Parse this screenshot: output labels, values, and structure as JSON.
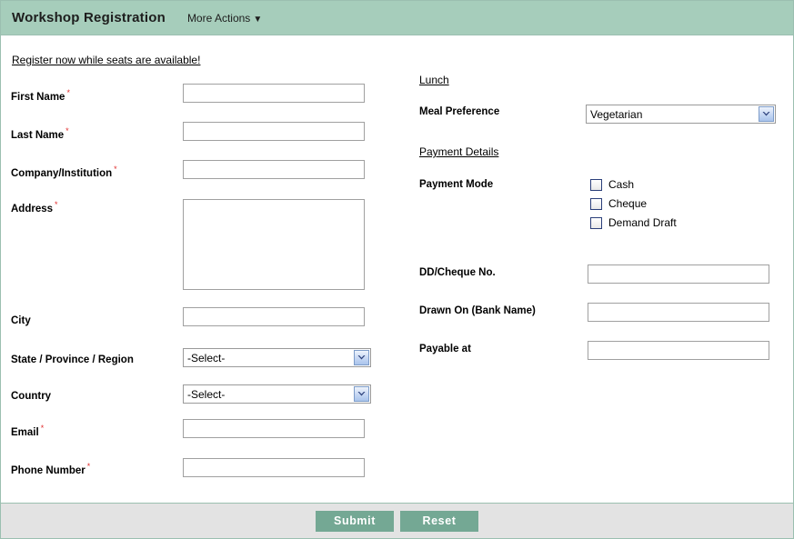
{
  "header": {
    "title": "Workshop Registration",
    "more_actions_label": "More Actions",
    "caret_icon": "chevron-down-icon"
  },
  "intro": {
    "text": "Register now while seats are available!"
  },
  "theme": {
    "header_bg": "#a6cdbb",
    "button_bg": "#74a894",
    "footer_bg": "#e3e3e3",
    "border": "#9bbfb0",
    "required_mark": "#e03030"
  },
  "left_column": {
    "fields": [
      {
        "label": "First Name",
        "required": "*",
        "type": "text",
        "value": ""
      },
      {
        "label": "Last Name",
        "required": "*",
        "type": "text",
        "value": ""
      },
      {
        "label": "Company/Institution",
        "required": "*",
        "type": "text",
        "value": ""
      },
      {
        "label": "Address",
        "required": "*",
        "type": "textarea",
        "value": ""
      },
      {
        "label": "City",
        "required": "",
        "type": "text",
        "value": ""
      },
      {
        "label": "State / Province / Region",
        "required": "",
        "type": "select",
        "value": "-Select-"
      },
      {
        "label": "Country",
        "required": "",
        "type": "select",
        "value": "-Select-"
      },
      {
        "label": "Email",
        "required": "*",
        "type": "text",
        "value": ""
      },
      {
        "label": "Phone Number",
        "required": "*",
        "type": "text",
        "value": ""
      }
    ]
  },
  "right_column": {
    "lunch_heading": "Lunch",
    "meal_label": "Meal Preference",
    "meal_value": "Vegetarian",
    "payment_heading": "Payment Details",
    "payment_mode_label": "Payment Mode",
    "payment_modes": [
      {
        "label": "Cash",
        "checked": false
      },
      {
        "label": "Cheque",
        "checked": false
      },
      {
        "label": "Demand Draft",
        "checked": false
      }
    ],
    "fields": [
      {
        "label": "DD/Cheque No.",
        "value": ""
      },
      {
        "label": "Drawn On (Bank Name)",
        "value": ""
      },
      {
        "label": "Payable at",
        "value": ""
      }
    ]
  },
  "footer": {
    "submit_label": "Submit",
    "reset_label": "Reset"
  }
}
